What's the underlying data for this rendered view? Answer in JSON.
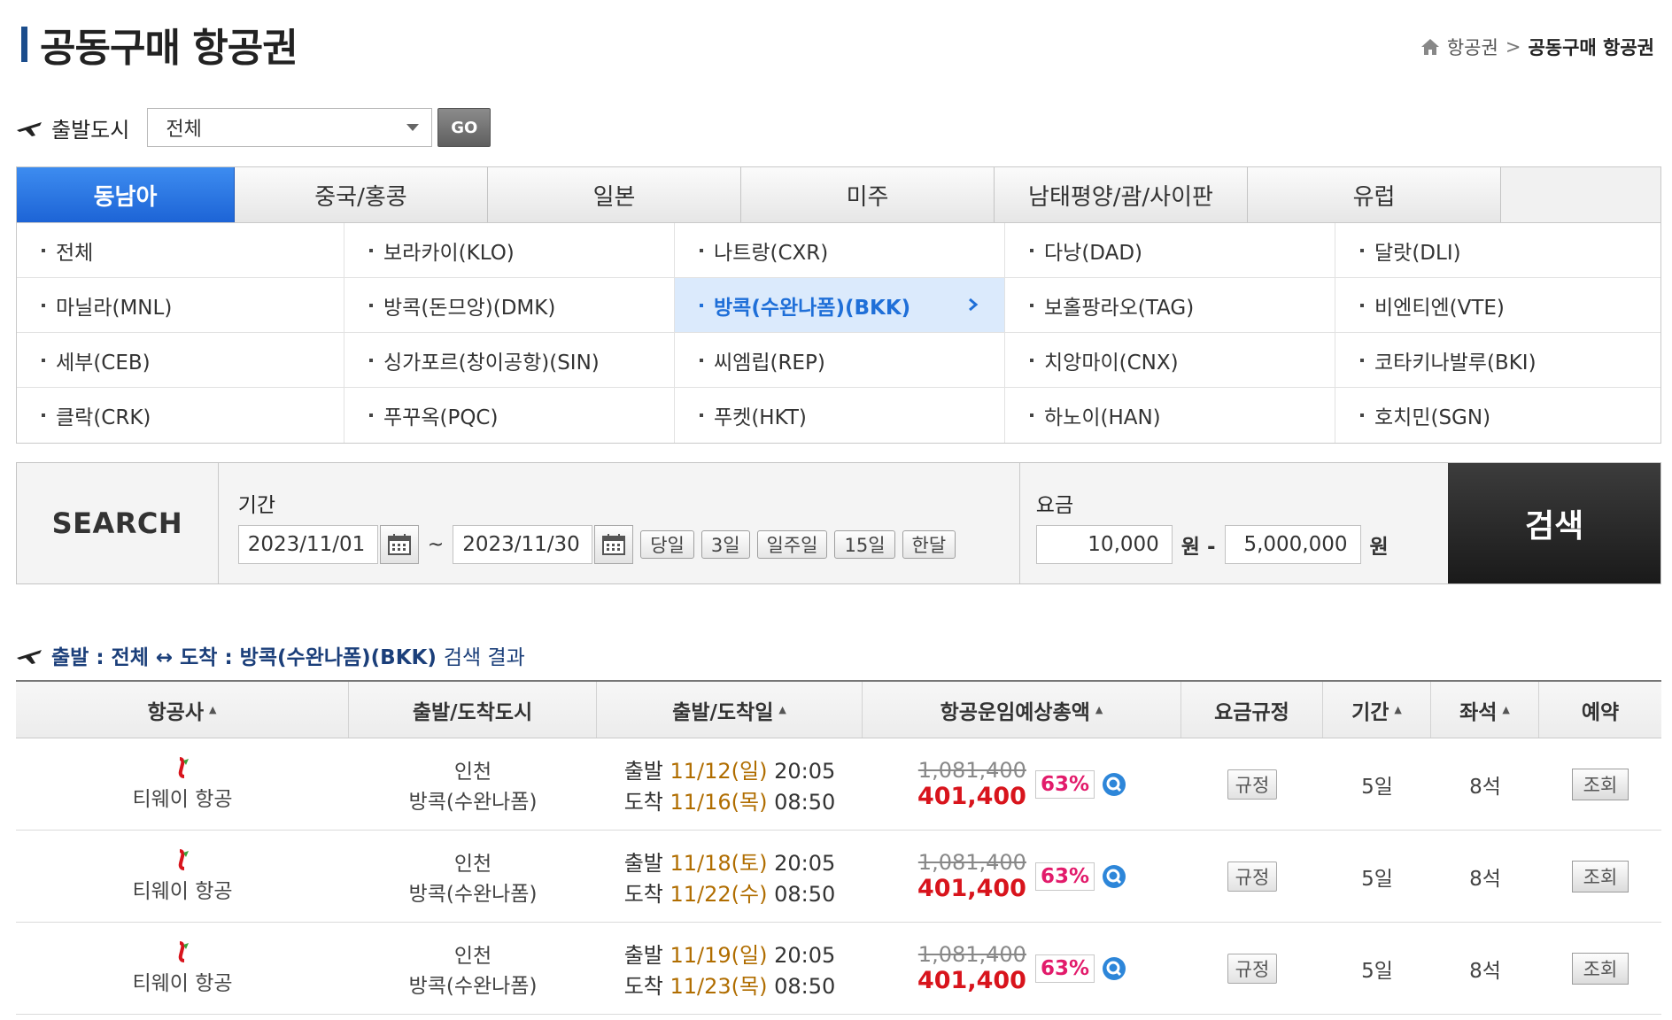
{
  "page": {
    "title": "공동구매 항공권",
    "breadcrumb": [
      "항공권",
      "공동구매 항공권"
    ]
  },
  "departure": {
    "label": "출발도시",
    "selected": "전체",
    "go_label": "GO"
  },
  "tabs": [
    {
      "label": "동남아",
      "active": true
    },
    {
      "label": "중국/홍콩",
      "active": false
    },
    {
      "label": "일본",
      "active": false
    },
    {
      "label": "미주",
      "active": false
    },
    {
      "label": "남태평양/괌/사이판",
      "active": false
    },
    {
      "label": "유럽",
      "active": false
    }
  ],
  "cities": [
    {
      "label": "전체"
    },
    {
      "label": "보라카이(KLO)"
    },
    {
      "label": "나트랑(CXR)"
    },
    {
      "label": "다낭(DAD)"
    },
    {
      "label": "달랏(DLI)"
    },
    {
      "label": "마닐라(MNL)"
    },
    {
      "label": "방콕(돈므앙)(DMK)"
    },
    {
      "label": "방콕(수완나폼)(BKK)",
      "selected": true
    },
    {
      "label": "보홀팡라오(TAG)"
    },
    {
      "label": "비엔티엔(VTE)"
    },
    {
      "label": "세부(CEB)"
    },
    {
      "label": "싱가포르(창이공항)(SIN)"
    },
    {
      "label": "씨엠립(REP)"
    },
    {
      "label": "치앙마이(CNX)"
    },
    {
      "label": "코타키나발루(BKI)"
    },
    {
      "label": "클락(CRK)"
    },
    {
      "label": "푸꾸옥(PQC)"
    },
    {
      "label": "푸켓(HKT)"
    },
    {
      "label": "하노이(HAN)"
    },
    {
      "label": "호치민(SGN)"
    }
  ],
  "search": {
    "label": "SEARCH",
    "period_label": "기간",
    "date_from": "2023/11/01",
    "date_to": "2023/11/30",
    "tilde": "~",
    "quick": [
      "당일",
      "3일",
      "일주일",
      "15일",
      "한달"
    ],
    "fare_label": "요금",
    "fare_min": "10,000",
    "fare_max": "5,000,000",
    "won1": "원 -",
    "won2": "원",
    "button": "검색"
  },
  "result": {
    "heading": "출발 : 전체 ↔ 도착 : 방콕(수완나폼)(BKK)",
    "suffix": "검색 결과"
  },
  "table": {
    "columns": [
      {
        "label": "항공사",
        "sortable": true
      },
      {
        "label": "출발/도착도시",
        "sortable": false
      },
      {
        "label": "출발/도착일",
        "sortable": true
      },
      {
        "label": "항공운임예상총액",
        "sortable": true
      },
      {
        "label": "요금규정",
        "sortable": false
      },
      {
        "label": "기간",
        "sortable": true
      },
      {
        "label": "좌석",
        "sortable": true
      },
      {
        "label": "예약",
        "sortable": false
      }
    ],
    "sort_glyph": "▲",
    "rows": [
      {
        "airline": "티웨이 항공",
        "from": "인천",
        "to": "방콕(수완나폼)",
        "dep_prefix": "출발",
        "dep_date": "11/12(일)",
        "dep_time": "20:05",
        "arr_prefix": "도착",
        "arr_date": "11/16(목)",
        "arr_time": "08:50",
        "orig_price": "1,081,400",
        "sale_price": "401,400",
        "discount": "63%",
        "rule": "규정",
        "period": "5일",
        "seats": "8석",
        "reserve": "조회"
      },
      {
        "airline": "티웨이 항공",
        "from": "인천",
        "to": "방콕(수완나폼)",
        "dep_prefix": "출발",
        "dep_date": "11/18(토)",
        "dep_time": "20:05",
        "arr_prefix": "도착",
        "arr_date": "11/22(수)",
        "arr_time": "08:50",
        "orig_price": "1,081,400",
        "sale_price": "401,400",
        "discount": "63%",
        "rule": "규정",
        "period": "5일",
        "seats": "8석",
        "reserve": "조회"
      },
      {
        "airline": "티웨이 항공",
        "from": "인천",
        "to": "방콕(수완나폼)",
        "dep_prefix": "출발",
        "dep_date": "11/19(일)",
        "dep_time": "20:05",
        "arr_prefix": "도착",
        "arr_date": "11/23(목)",
        "arr_time": "08:50",
        "orig_price": "1,081,400",
        "sale_price": "401,400",
        "discount": "63%",
        "rule": "규정",
        "period": "5일",
        "seats": "8석",
        "reserve": "조회"
      }
    ]
  },
  "colors": {
    "tab_active": "#1d64d6",
    "sale_price": "#d8141c",
    "discount": "#e21b6b",
    "date_highlight": "#b06d00",
    "selected_city": "#1f6fd8",
    "heading_navy": "#1b3f7a"
  },
  "icons": {
    "home": "home-icon",
    "plane": "airplane-icon",
    "calendar": "calendar-icon",
    "zoom": "magnifier-icon",
    "airline_logo": "tway-logo-icon",
    "arrow": "chevron-right-icon"
  }
}
